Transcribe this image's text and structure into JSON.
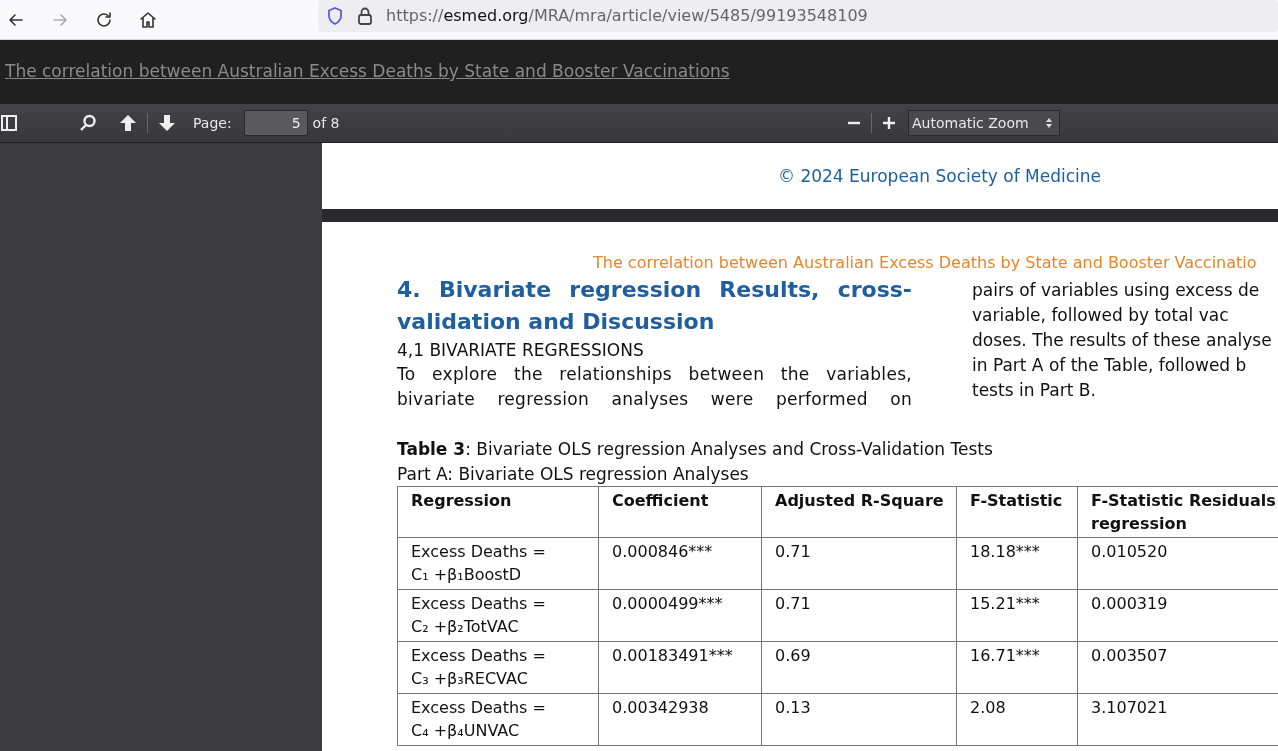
{
  "browser": {
    "back_disabled": false,
    "forward_disabled": true,
    "url_scheme": "https://",
    "url_host": "esmed.org",
    "url_path": "/MRA/mra/article/view/5485/99193548109"
  },
  "banner": {
    "link": "The correlation between Australian Excess Deaths by State and Booster Vaccinations"
  },
  "pdf_toolbar": {
    "page_label": "Page:",
    "page_value": "5",
    "page_count": "of 8",
    "zoom": "Automatic Zoom"
  },
  "previous_page": {
    "footer": "© 2024 European Society of Medicine"
  },
  "page": {
    "running_header": "The correlation between Australian Excess Deaths by State and Booster Vaccinatio",
    "heading_lines": [
      "4. Bivariate regression Results, cross-",
      "validation and Discussion"
    ],
    "subheading": "4,1 BIVARIATE REGRESSIONS",
    "left_lines": [
      "To explore the relationships between the variables,",
      "bivariate regression analyses were performed on"
    ],
    "right_lines": [
      "pairs of variables using excess de",
      "variable, followed by total vac",
      "doses. The results of these analyse",
      "in Part A of the Table, followed b",
      "tests in Part B."
    ],
    "table_caption": "**Table 3**: Bivariate OLS regression Analyses and Cross-Validation Tests",
    "table_part": "Part A: Bivariate OLS regression Analyses",
    "table": {
      "columns": [
        "Regression",
        "Coefficient",
        "Adjusted R-Square",
        "F-Statistic",
        "F-Statistic Residuals regression"
      ],
      "rows": [
        [
          [
            "Excess Deaths =",
            "C₁ +β₁BoostD"
          ],
          "0.000846***",
          "0.71",
          "18.18***",
          "0.010520"
        ],
        [
          [
            "Excess Deaths =",
            "C₂ +β₂TotVAC"
          ],
          "0.0000499***",
          "0.71",
          "15.21***",
          "0.000319"
        ],
        [
          [
            "Excess Deaths =",
            "C₃ +β₃RECVAC"
          ],
          "0.00183491***",
          "0.69",
          "16.71***",
          "0.003507"
        ],
        [
          [
            "Excess Deaths =",
            "C₄ +β₄UNVAC"
          ],
          "0.00342938",
          "0.13",
          "2.08",
          "3.107021"
        ]
      ]
    }
  }
}
